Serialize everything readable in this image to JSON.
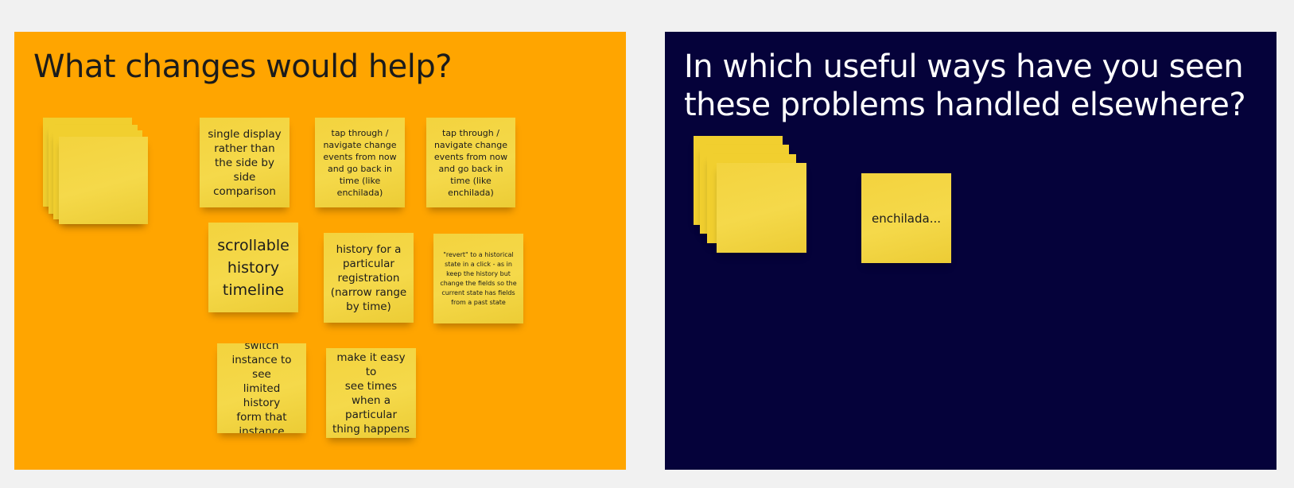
{
  "frames": {
    "left": {
      "title": "What changes would help?",
      "color": "#ffa500",
      "notes": [
        {
          "text": "single display\nrather than\nthe side by\nside\ncomparison"
        },
        {
          "text": "tap through /\nnavigate change\nevents from now\nand go back in\ntime (like\nenchilada)"
        },
        {
          "text": "tap through /\nnavigate change\nevents from now\nand go back in\ntime (like\nenchilada)"
        },
        {
          "text": "scrollable\nhistory\ntimeline"
        },
        {
          "text": "history for a\nparticular\nregistration\n(narrow range\nby time)"
        },
        {
          "text": "\"revert\" to a historical\nstate in a click - as in\nkeep the history but\nchange the fields so the\ncurrent state has fields\nfrom a past state"
        },
        {
          "text": "switch\ninstance to see\nlimited history\nform that\ninstance"
        },
        {
          "text": "make it easy to\nsee times\nwhen a\nparticular\nthing happens"
        }
      ]
    },
    "right": {
      "title": "In which useful ways have you seen these problems handled elsewhere?",
      "color": "#05023a",
      "notes": [
        {
          "text": "enchilada..."
        }
      ]
    }
  },
  "colors": {
    "background": "#f1f1f1",
    "sticky_note": "#f3d33e",
    "dark_text": "#1b1b1b",
    "light_text": "#ffffff"
  }
}
